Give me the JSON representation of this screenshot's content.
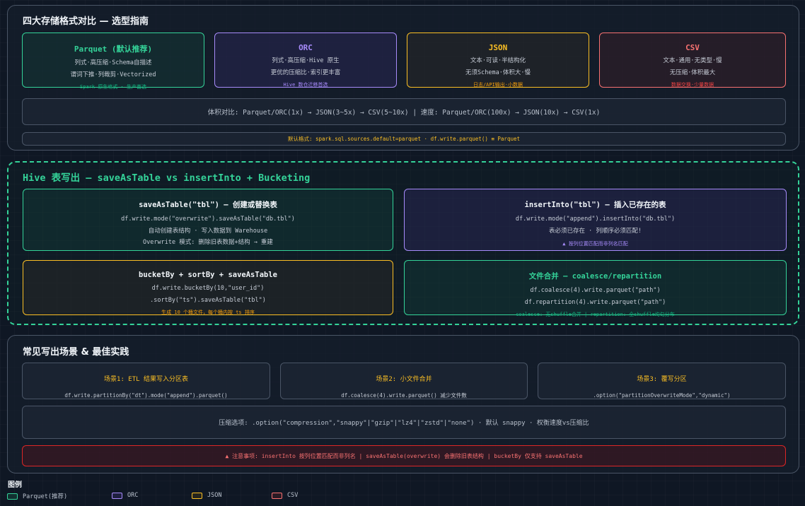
{
  "section1": {
    "title": "四大存储格式对比 — 选型指南",
    "cards": [
      {
        "title": "Parquet (默认推荐)",
        "line1": "列式·高压缩·Schema自描述",
        "line2": "谓词下推·列裁剪·Vectorized",
        "note": "Spark 原生格式 · 生产首选"
      },
      {
        "title": "ORC",
        "line1": "列式·高压缩·Hive 原生",
        "line2": "更优的压缩比·索引更丰富",
        "note": "Hive 数仓迁移首选"
      },
      {
        "title": "JSON",
        "line1": "文本·可读·半结构化",
        "line2": "无须Schema·体积大·慢",
        "note": "日志/API输出·小数据"
      },
      {
        "title": "CSV",
        "line1": "文本·通用·无类型·慢",
        "line2": "无压缩·体积最大",
        "note": "数据交换·少量数据"
      }
    ],
    "compare_line": "体积对比: Parquet/ORC(1x) → JSON(3~5x) → CSV(5~10x) | 速度: Parquet/ORC(100x) → JSON(10x) → CSV(1x)",
    "default_line": "默认格式: spark.sql.sources.default=parquet · df.write.parquet() ≡ Parquet"
  },
  "section2": {
    "title": "Hive 表写出 — saveAsTable vs insertInto + Bucketing",
    "cards": [
      {
        "title": "saveAsTable(\"tbl\") — 创建或替换表",
        "line1": "df.write.mode(\"overwrite\").saveAsTable(\"db.tbl\")",
        "line2": "自动创建表结构 · 写入数据到 Warehouse",
        "line3": "Overwrite 模式: 删除旧表数据+结构 → 重建"
      },
      {
        "title": "insertInto(\"tbl\") — 插入已存在的表",
        "line1": "df.write.mode(\"append\").insertInto(\"db.tbl\")",
        "line2": "表必须已存在 · 列顺序必须匹配!",
        "note": "▲ 按列位置匹配而非列名匹配"
      },
      {
        "title": "bucketBy + sortBy + saveAsTable",
        "line1": "df.write.bucketBy(10,\"user_id\")",
        "line2": ".sortBy(\"ts\").saveAsTable(\"tbl\")",
        "note": "生成 10 个桶文件，每个桶内按 ts 排序"
      },
      {
        "title": "文件合并 — coalesce/repartition",
        "line1": "df.coalesce(4).write.parquet(\"path\")",
        "line2": "df.repartition(4).write.parquet(\"path\")",
        "note": "coalesce: 无shuffle合并 | repartition: 全shuffle均匀分布"
      }
    ]
  },
  "section3": {
    "title": "常见写出场景 & 最佳实践",
    "scenes": [
      {
        "title": "场景1: ETL 结果写入分区表",
        "code": "df.write.partitionBy(\"dt\").mode(\"append\").parquet()"
      },
      {
        "title": "场景2: 小文件合并",
        "code": "df.coalesce(4).write.parquet() 减少文件数"
      },
      {
        "title": "场景3: 覆写分区",
        "code": ".option(\"partitionOverwriteMode\",\"dynamic\")"
      }
    ],
    "compression_line": "压缩选项: .option(\"compression\",\"snappy\"|\"gzip\"|\"lz4\"|\"zstd\"|\"none\") · 默认 snappy · 权衡速度vs压缩比",
    "warning_line": "▲ 注意事项: insertInto 按列位置匹配而非列名 | saveAsTable(overwrite) 会删除旧表结构 | bucketBy 仅支持 saveAsTable"
  },
  "legend": {
    "title": "图例",
    "items": [
      {
        "label": "Parquet(推荐)",
        "color": "#34d399"
      },
      {
        "label": "ORC",
        "color": "#a78bfa"
      },
      {
        "label": "JSON",
        "color": "#fbbf24"
      },
      {
        "label": "CSV",
        "color": "#f87171"
      }
    ]
  }
}
